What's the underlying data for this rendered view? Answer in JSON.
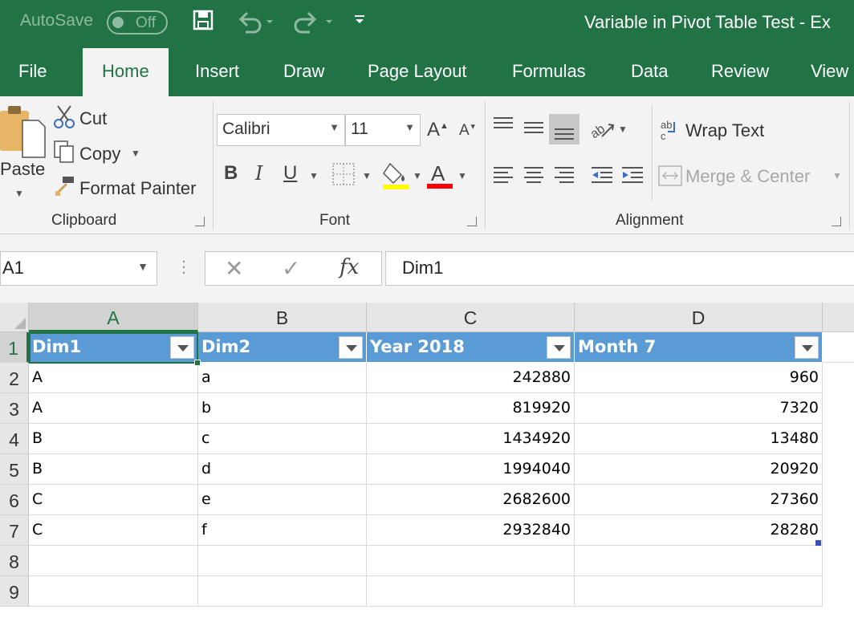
{
  "titlebar": {
    "autosave_label": "AutoSave",
    "toggle_state": "Off",
    "doc_title": "Variable in Pivot Table Test  -  Ex"
  },
  "tabs": [
    "File",
    "Home",
    "Insert",
    "Draw",
    "Page Layout",
    "Formulas",
    "Data",
    "Review",
    "View"
  ],
  "active_tab": "Home",
  "clipboard": {
    "paste_label": "Paste",
    "cut_label": "Cut",
    "copy_label": "Copy",
    "format_painter_label": "Format Painter",
    "group_label": "Clipboard"
  },
  "font": {
    "font_name": "Calibri",
    "font_size": "11",
    "group_label": "Font",
    "highlight_color": "#ffff00",
    "font_color": "#ff0000"
  },
  "alignment": {
    "wrap_text_label": "Wrap Text",
    "merge_center_label": "Merge & Center",
    "group_label": "Alignment"
  },
  "formula_bar": {
    "name_box": "A1",
    "formula_value": "Dim1"
  },
  "sheet": {
    "columns": [
      "A",
      "B",
      "C",
      "D"
    ],
    "row_numbers": [
      "1",
      "2",
      "3",
      "4",
      "5",
      "6",
      "7",
      "8",
      "9"
    ],
    "headers": [
      "Dim1",
      "Dim2",
      "Year 2018",
      "Month 7"
    ],
    "rows": [
      [
        "A",
        "a",
        "242880",
        "960"
      ],
      [
        "A",
        "b",
        "819920",
        "7320"
      ],
      [
        "B",
        "c",
        "1434920",
        "13480"
      ],
      [
        "B",
        "d",
        "1994040",
        "20920"
      ],
      [
        "C",
        "e",
        "2682600",
        "27360"
      ],
      [
        "C",
        "f",
        "2932840",
        "28280"
      ]
    ],
    "header_color": "#5b9bd5",
    "accent_color": "#217346"
  }
}
